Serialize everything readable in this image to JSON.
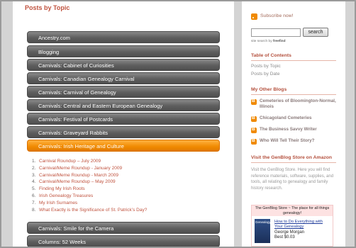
{
  "main": {
    "title": "Posts by Topic",
    "topics": [
      "Ancestry.com",
      "Blogging",
      "Carnivals: Cabinet of Curiosities",
      "Carnivals: Canadian Genealogy Carnival",
      "Carnivals: Carnival of Genealogy",
      "Carnivals: Central and Eastern European Genealogy",
      "Carnivals: Festival of Postcards",
      "Carnivals: Graveyard Rabbits",
      "Carnivals: Irish Heritage and Culture"
    ],
    "posts": [
      {
        "num": "1.",
        "title": "Carnival Roundup – July 2009"
      },
      {
        "num": "2.",
        "title": "Carnival/Meme Roundup - January 2009"
      },
      {
        "num": "3.",
        "title": "Carnival/Meme Roundup - March 2009"
      },
      {
        "num": "4.",
        "title": "Carnival/Meme Roundup – May 2009"
      },
      {
        "num": "5.",
        "title": "Finding My Irish Roots"
      },
      {
        "num": "6.",
        "title": "Irish Genealogy Treasures"
      },
      {
        "num": "7.",
        "title": "My Irish Surnames"
      },
      {
        "num": "8.",
        "title": "What Exactly is the Significance of St. Patrick’s Day?"
      }
    ],
    "topics_after": [
      "Carnivals: Smile for the Camera",
      "Columns: 52 Weeks"
    ]
  },
  "sidebar": {
    "subscribe": "Subscribe now!",
    "search_button": "search",
    "search_credit_prefix": "site search by ",
    "search_credit_brand": "freefind",
    "toc_heading": "Table of Contents",
    "toc_links": [
      "Posts by Topic",
      "Posts by Date"
    ],
    "blogs_heading": "My Other Blogs",
    "blogs": [
      "Cemeteries of Bloomington-Normal, Illinois",
      "Chicagoland Cemeteries",
      "The Business Savvy Writer",
      "Who Will Tell Their Story?"
    ],
    "store_heading": "Visit the GenBlog Store on Amazon",
    "store_text": "Visit the GenBlog Store. Here you will find reference materials, software, supplies, and tools, all relating to genealogy and family history research.",
    "widget_head": "The GenBlog Store ~ The place for all things genealogy!",
    "book_cover": "Genealogy",
    "book_title": "How to Do Everything with Your Genealogy",
    "book_author": "George Morgan",
    "book_price": "Best $0.03"
  },
  "colors": {
    "accent": "#c0533f",
    "active_bar": "#f08a00",
    "bar": "#5e5e5e"
  }
}
